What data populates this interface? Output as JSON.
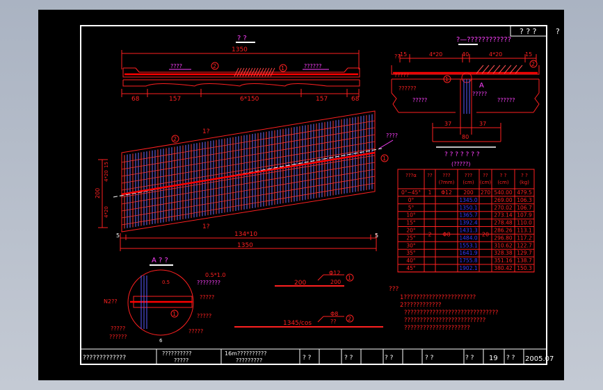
{
  "colors": {
    "background": "#000000",
    "frame": "#ffffff",
    "red": "#ff2020",
    "magenta": "#ff40ff",
    "blue": "#2a2aff",
    "hatch_blue": "#5a5aff",
    "green": "#00ff00"
  },
  "section_title": "? ?",
  "detail_title": "?—????????????",
  "corner_title": "? ? ?",
  "corner_mark": "?",
  "plan_title": "1?",
  "plan_bottom_title": "1?",
  "table_title": "? ? ? ? ? ? ?",
  "table_subtitle": "(?????)",
  "label_A_view": "A ? ?",
  "label_A": "A",
  "dims": {
    "total_top": "1350",
    "seg_68": "68",
    "seg_157": "157",
    "seg_mid": "6*150",
    "det_15": "15",
    "det_4x20": "4*20",
    "det_40": "40",
    "det_37": "37",
    "det_80": "80",
    "plan_200": "200",
    "plan_4x20": "4*20",
    "plan_15": "15",
    "plan_bottom": "134*10",
    "plan_total": "1350",
    "plan_5": "5",
    "bar1_len": "200",
    "bar1_spec": "Φ12",
    "bar1_spec2": "200",
    "bar2_len": "1345/cos",
    "bar2_spec": "Φ8",
    "bar2_spec2": "??"
  },
  "circle_labels": {
    "one": "1",
    "two": "2"
  },
  "annotations": {
    "sec_left": "????",
    "sec_right": "??????",
    "det_left_top": "??",
    "det_left1": "?????",
    "det_left2": "??????",
    "det_mag1": "?????",
    "det_mag2": "?????",
    "det_mag3": "??????",
    "plan_mag": "????",
    "A_n2": "N2??",
    "A_r1a": "0.5*1.0",
    "A_r1b": "????????",
    "A_r2": "?????",
    "A_r3": "?????",
    "A_r4": "?????",
    "A_l1": "?????",
    "A_l2": "??????",
    "A_05": "0.5",
    "A_6": "6"
  },
  "table": {
    "headers": [
      "???α",
      "??",
      "???\n(?mm)",
      "???\n(cm)",
      "??\n(cm)",
      "? ?\n(cm)",
      "? ?\n(kg)"
    ],
    "first_row": {
      "angle": "0°~45°",
      "no": "1",
      "dia": "Φ12",
      "len": "200",
      "count": "270",
      "total": "540.00",
      "weight": "479.5"
    },
    "no2": "2",
    "dia2": "Φ8",
    "count2": "20",
    "rows": [
      {
        "angle": "0°",
        "len": "1345.0",
        "total": "269.00",
        "weight": "106.3"
      },
      {
        "angle": "5°",
        "len": "1350.1",
        "total": "270.02",
        "weight": "106.7"
      },
      {
        "angle": "10°",
        "len": "1365.7",
        "total": "273.14",
        "weight": "107.9"
      },
      {
        "angle": "15°",
        "len": "1392.4",
        "total": "278.48",
        "weight": "110.0"
      },
      {
        "angle": "20°",
        "len": "1431.3",
        "total": "286.26",
        "weight": "113.1"
      },
      {
        "angle": "25°",
        "len": "1484.0",
        "total": "296.80",
        "weight": "117.2"
      },
      {
        "angle": "30°",
        "len": "1553.1",
        "total": "310.62",
        "weight": "122.7"
      },
      {
        "angle": "35°",
        "len": "1641.9",
        "total": "328.38",
        "weight": "129.7"
      },
      {
        "angle": "40°",
        "len": "1755.8",
        "total": "351.16",
        "weight": "138.7"
      },
      {
        "angle": "45°",
        "len": "1902.1",
        "total": "380.42",
        "weight": "150.3"
      }
    ]
  },
  "notes": {
    "title": "???",
    "lines": [
      "1???????????????????????",
      "2????????????",
      "??????????????????????????????",
      "??????????????????????????",
      "?????????????????????"
    ]
  },
  "title_block": {
    "project": "?????????????",
    "drawing": "??????????",
    "drawing2": "?????",
    "desc": "16m??????????",
    "desc2": "?????????",
    "cells": [
      "? ?",
      "? ?",
      "? ?",
      "? ?",
      "? ?"
    ],
    "sheet_no": "19",
    "date_label": "? ?",
    "date": "2005.07"
  }
}
